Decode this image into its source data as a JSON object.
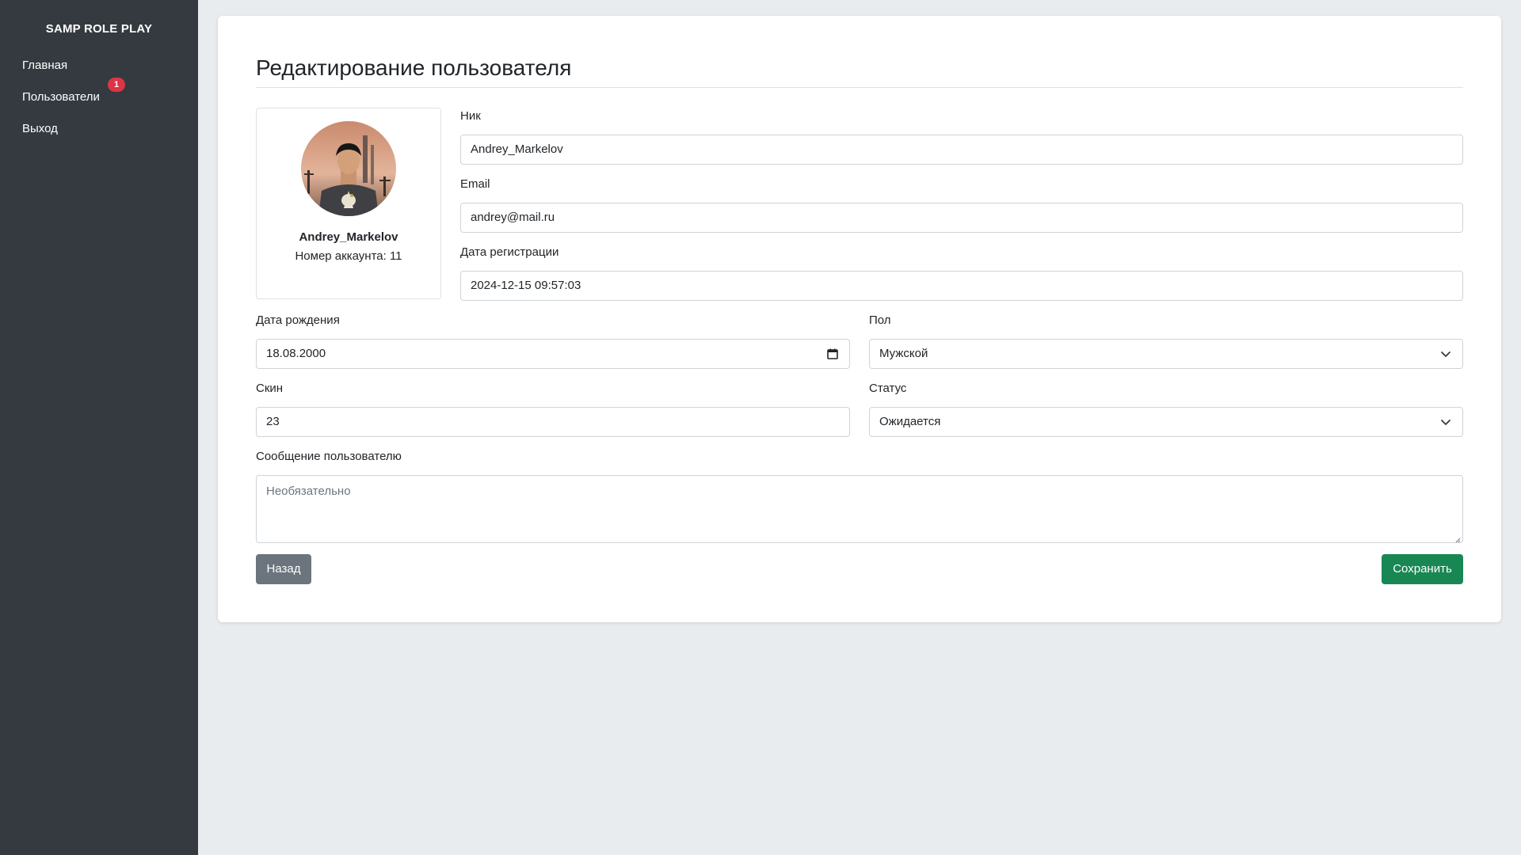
{
  "sidebar": {
    "brand": "SAMP ROLE PLAY",
    "items": [
      {
        "label": "Главная"
      },
      {
        "label": "Пользователи",
        "badge": "1"
      },
      {
        "label": "Выход"
      }
    ]
  },
  "page": {
    "title": "Редактирование пользователя"
  },
  "profile": {
    "name": "Andrey_Markelov",
    "account": "Номер аккаунта: 11"
  },
  "form": {
    "nick": {
      "label": "Ник",
      "value": "Andrey_Markelov"
    },
    "email": {
      "label": "Email",
      "value": "andrey@mail.ru"
    },
    "reg_date": {
      "label": "Дата регистрации",
      "value": "2024-12-15 09:57:03"
    },
    "birth_date": {
      "label": "Дата рождения",
      "value": "18.08.2000"
    },
    "gender": {
      "label": "Пол",
      "value": "Мужской"
    },
    "skin": {
      "label": "Скин",
      "value": "23"
    },
    "status": {
      "label": "Статус",
      "value": "Ожидается"
    },
    "message": {
      "label": "Сообщение пользователю",
      "placeholder": "Необязательно"
    }
  },
  "buttons": {
    "back": "Назад",
    "save": "Сохранить"
  },
  "icons": {
    "date": "calendar-icon",
    "select": "chevron-down-icon",
    "resize": "resize-grip-icon"
  },
  "colors": {
    "sidebar": "#343a40",
    "badge": "#dc3545",
    "back": "#6c757d",
    "save": "#198754",
    "page_bg": "#e9ecef"
  }
}
